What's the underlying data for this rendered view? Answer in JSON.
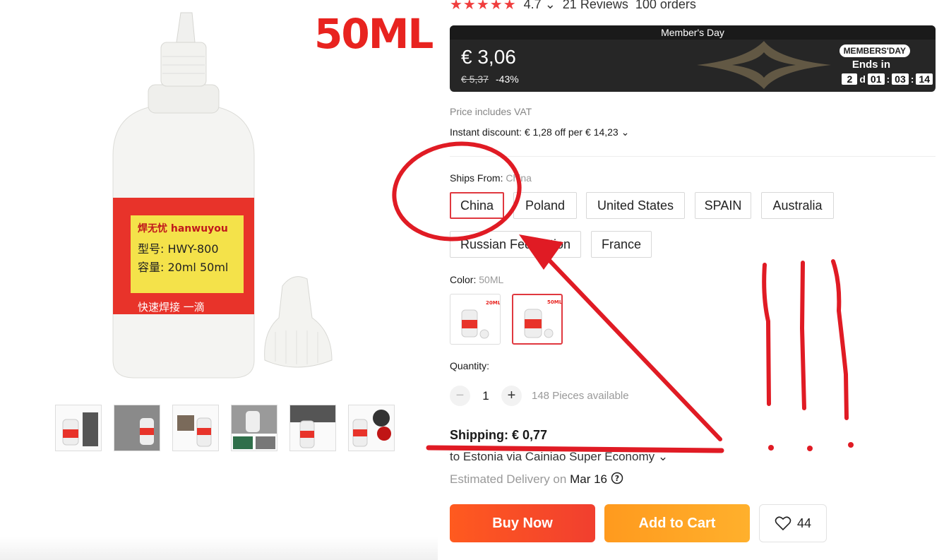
{
  "product_image": {
    "promo_text": "50ML",
    "label_lines": [
      "焊无忧 hanwuyou",
      "型号: HWY-800",
      "容量: 20ml 50ml",
      "快速焊接"
    ]
  },
  "thumbnails": [
    "thumb-1",
    "thumb-2",
    "thumb-3",
    "thumb-4",
    "thumb-5",
    "thumb-6"
  ],
  "rating": {
    "stars": "★★★★★",
    "score": "4.7",
    "reviews": "21 Reviews",
    "orders": "100 orders"
  },
  "banner": {
    "title": "Member's Day",
    "price": "€ 3,06",
    "old_price": "€ 5,37",
    "discount": "-43%",
    "badge": "MEMBERS'DAY",
    "ends_in": "Ends in",
    "countdown": {
      "days": "2",
      "days_unit": "d",
      "hours": "01",
      "minutes": "03",
      "seconds": "14"
    }
  },
  "vat_note": "Price includes VAT",
  "instant_discount": "Instant discount: € 1,28 off per € 14,23",
  "ships_from": {
    "label": "Ships From:",
    "selected": "China",
    "options": [
      "China",
      "Poland",
      "United States",
      "SPAIN",
      "Australia",
      "Russian Federation",
      "France"
    ]
  },
  "color": {
    "label": "Color:",
    "selected": "50ML",
    "option_labels": [
      "20ML",
      "50ML"
    ]
  },
  "quantity": {
    "label": "Quantity:",
    "value": "1",
    "minus": "−",
    "plus": "+",
    "available": "148 Pieces available"
  },
  "shipping": {
    "cost": "Shipping: € 0,77",
    "route": "to Estonia via Cainiao Super Economy",
    "est_prefix": "Estimated Delivery on",
    "est_date": "Mar 16"
  },
  "actions": {
    "buy_now": "Buy Now",
    "add_to_cart": "Add to Cart",
    "wishlist_count": "44"
  },
  "colors": {
    "accent_red": "#e0383f",
    "buy_orange": "#ff5a1f",
    "cart_orange": "#ffa325",
    "annotation_red": "#e01b24"
  }
}
